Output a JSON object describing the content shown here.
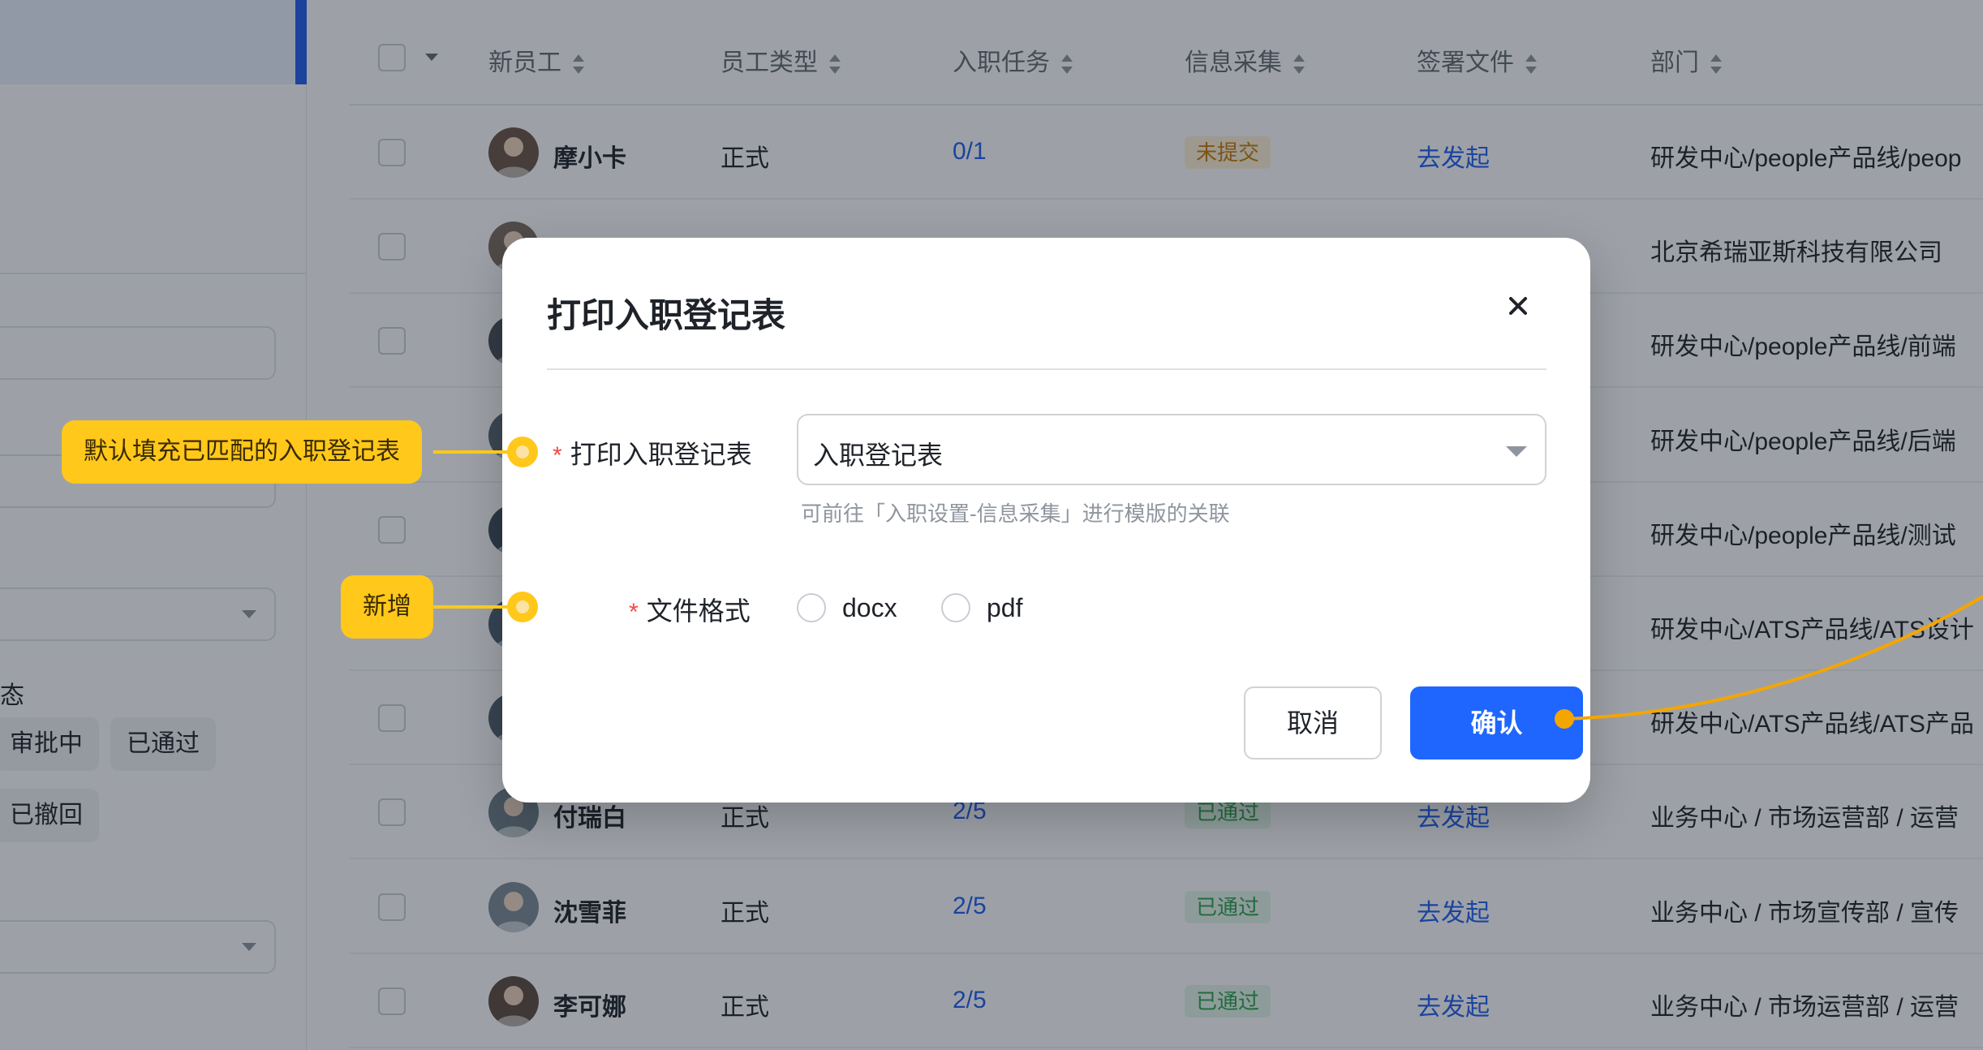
{
  "sidebar": {
    "status_label": "态",
    "chips": [
      "审批中",
      "已通过",
      "已撤回"
    ]
  },
  "table": {
    "headers": {
      "employee": "新员工",
      "type": "员工类型",
      "task": "入职任务",
      "info": "信息采集",
      "sign": "签署文件",
      "dept": "部门"
    },
    "rows": [
      {
        "name": "摩小卡",
        "type": "正式",
        "task": "0/1",
        "info": "未提交",
        "info_status": "warn",
        "sign": "去发起",
        "dept": "研发中心/people产品线/peop"
      },
      {
        "name": "",
        "type": "",
        "task": "",
        "info": "",
        "info_status": "",
        "sign": "",
        "dept": "北京希瑞亚斯科技有限公司"
      },
      {
        "name": "",
        "type": "",
        "task": "",
        "info": "",
        "info_status": "",
        "sign": "",
        "dept": "研发中心/people产品线/前端"
      },
      {
        "name": "",
        "type": "",
        "task": "",
        "info": "",
        "info_status": "",
        "sign": "",
        "dept": "研发中心/people产品线/后端"
      },
      {
        "name": "",
        "type": "",
        "task": "",
        "info": "",
        "info_status": "",
        "sign": "",
        "dept": "研发中心/people产品线/测试"
      },
      {
        "name": "",
        "type": "",
        "task": "",
        "info": "",
        "info_status": "",
        "sign": "",
        "dept": "研发中心/ATS产品线/ATS设计"
      },
      {
        "name": "",
        "type": "",
        "task": "",
        "info": "",
        "info_status": "",
        "sign": "",
        "dept": "研发中心/ATS产品线/ATS产品"
      },
      {
        "name": "付瑞白",
        "type": "正式",
        "task": "2/5",
        "info": "已通过",
        "info_status": "ok",
        "sign": "去发起",
        "dept": "业务中心 / 市场运营部 / 运营"
      },
      {
        "name": "沈雪菲",
        "type": "正式",
        "task": "2/5",
        "info": "已通过",
        "info_status": "ok",
        "sign": "去发起",
        "dept": "业务中心 / 市场宣传部 / 宣传"
      },
      {
        "name": "李可娜",
        "type": "正式",
        "task": "2/5",
        "info": "已通过",
        "info_status": "ok",
        "sign": "去发起",
        "dept": "业务中心 / 市场运营部 / 运营"
      }
    ]
  },
  "modal": {
    "title": "打印入职登记表",
    "close_icon": "close-icon",
    "form": {
      "template_label": "打印入职登记表",
      "template_value": "入职登记表",
      "template_hint": "可前往「入职设置-信息采集」进行模版的关联",
      "format_label": "文件格式",
      "format_options": [
        "docx",
        "pdf"
      ],
      "required_mark": "*"
    },
    "buttons": {
      "cancel": "取消",
      "confirm": "确认"
    }
  },
  "annotations": {
    "callout_1": "默认填充已匹配的入职登记表",
    "callout_2": "新增"
  },
  "colors": {
    "primary": "#1f66ff",
    "annotation": "#ffc81a",
    "confirm_connector": "#f5a500",
    "required": "#f54a45",
    "tag_warn": "#c67b00",
    "tag_ok": "#2ea14a"
  }
}
